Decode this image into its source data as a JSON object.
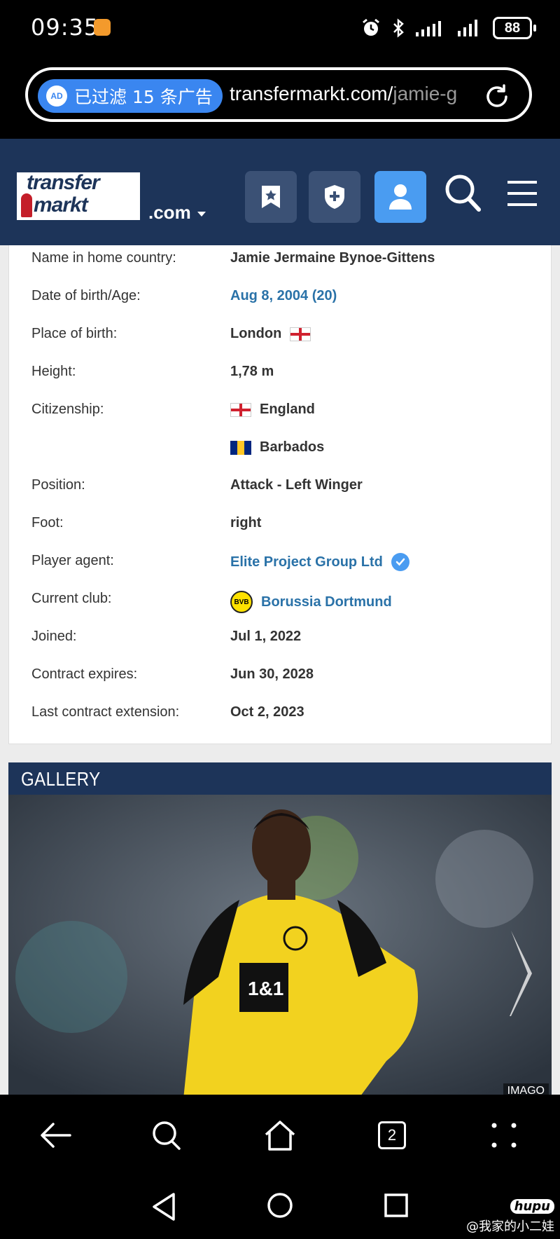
{
  "status_bar": {
    "time": "09:35",
    "battery": "88",
    "icons": [
      "alarm-icon",
      "bluetooth-icon",
      "signal-icon",
      "signal-icon"
    ]
  },
  "browser": {
    "ad_filter_icon": "AD",
    "ad_filter_text": "已过滤 15 条广告",
    "url_main": "transfermarkt.com/",
    "url_dim": "jamie-g",
    "tab_count": "2"
  },
  "site_header": {
    "logo_top": "transfer",
    "logo_bottom": "markt",
    "domain": ".com"
  },
  "player_info": [
    {
      "label": "Name in home country:",
      "value": "Jamie Jermaine Bynoe-Gittens",
      "type": "text"
    },
    {
      "label": "Date of birth/Age:",
      "value": "Aug 8, 2004 (20)",
      "type": "link"
    },
    {
      "label": "Place of birth:",
      "value": "London",
      "type": "text",
      "flag": "england"
    },
    {
      "label": "Height:",
      "value": "1,78 m",
      "type": "text"
    },
    {
      "label": "Citizenship:",
      "value": "England",
      "type": "text",
      "flag_before": "england"
    },
    {
      "label": "",
      "value": "Barbados",
      "type": "text",
      "flag_before": "barbados"
    },
    {
      "label": "Position:",
      "value": "Attack - Left Winger",
      "type": "text"
    },
    {
      "label": "Foot:",
      "value": "right",
      "type": "text"
    },
    {
      "label": "Player agent:",
      "value": "Elite Project Group Ltd",
      "type": "link",
      "verified": true
    },
    {
      "label": "Current club:",
      "value": "Borussia Dortmund",
      "type": "link",
      "crest": "BVB"
    },
    {
      "label": "Joined:",
      "value": "Jul 1, 2022",
      "type": "text"
    },
    {
      "label": "Contract expires:",
      "value": "Jun 30, 2028",
      "type": "text"
    },
    {
      "label": "Last contract extension:",
      "value": "Oct 2, 2023",
      "type": "text"
    }
  ],
  "gallery": {
    "title": "GALLERY",
    "credit": "IMAGO",
    "jersey_sponsor": "1&1",
    "crest": "BVB"
  },
  "watermark": {
    "brand": "hupu",
    "handle": "@我家的小二娃"
  },
  "colors": {
    "header_bg": "#1d3459",
    "accent_blue": "#4a9cf1",
    "link": "#2a72a8",
    "ad_pill": "#3a86f0"
  }
}
